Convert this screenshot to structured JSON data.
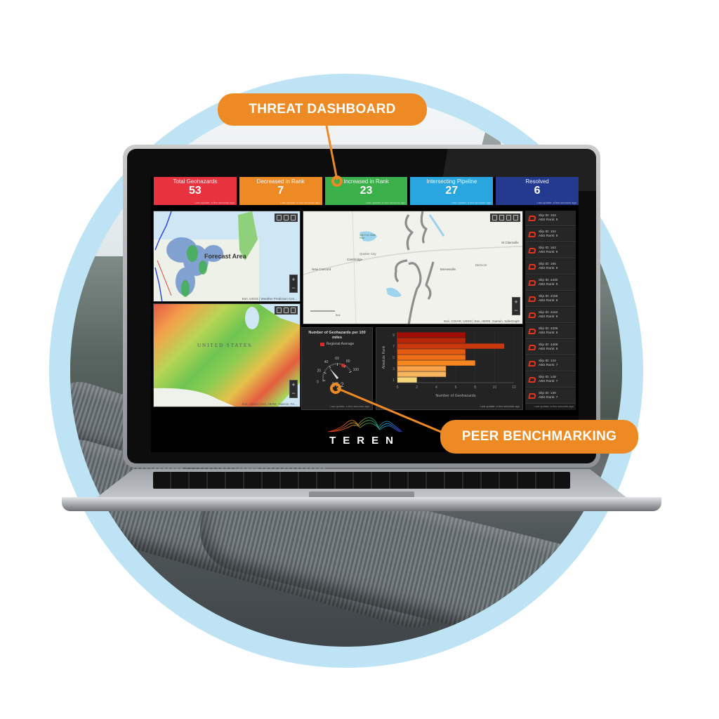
{
  "callouts": {
    "threat_dashboard": "THREAT DASHBOARD",
    "peer_benchmarking": "PEER BENCHMARKING",
    "color": "#ee8a24"
  },
  "dashboard": {
    "cards": [
      {
        "label": "Total Geohazards",
        "value": "53",
        "color": "#e8323e",
        "updated": "Last update: a few seconds ago"
      },
      {
        "label": "Decreased in Rank",
        "value": "7",
        "color": "#ee8a24",
        "updated": "Last update: a few seconds ago"
      },
      {
        "label": "Increased in Rank",
        "value": "23",
        "color": "#3aaf4a",
        "updated": "Last update: a few seconds ago"
      },
      {
        "label": "Intersecting Pipeline",
        "value": "27",
        "color": "#29a6e0",
        "updated": "Last update: a few seconds ago"
      },
      {
        "label": "Resolved",
        "value": "6",
        "color": "#233a8f",
        "updated": "Last update: a few seconds ago"
      }
    ],
    "maps": {
      "weather": {
        "label": "Forecast Area",
        "attribution": "Esri, USGS | Weather Prediction Cen..."
      },
      "heat": {
        "label": "UNITED STATES",
        "attribution": "Esri, USGS | Esri, HERE, Garmin, FA..."
      },
      "pipeline": {
        "places": [
          "New Concord",
          "Cambridge",
          "Salt Fork State Park",
          "Quaker City",
          "Barnesville",
          "Belmont",
          "St Clairsville"
        ],
        "scale": "5mi",
        "attribution": "Esri, CGIAR, USGS | Esri, HERE, Garmin, SafeGraph"
      },
      "zoom_in": "+",
      "zoom_out": "−"
    },
    "slips": [
      {
        "id": "Slip ID: 153",
        "rank": "ABS Rank: 9"
      },
      {
        "id": "Slip ID: 154",
        "rank": "ABS Rank: 9"
      },
      {
        "id": "Slip ID: 163",
        "rank": "ABS Rank: 9"
      },
      {
        "id": "Slip ID: 185",
        "rank": "ABS Rank: 9"
      },
      {
        "id": "Slip ID: 4430",
        "rank": "ABS Rank: 9"
      },
      {
        "id": "Slip ID: 4156",
        "rank": "ABS Rank: 8"
      },
      {
        "id": "Slip ID: 4162",
        "rank": "ABS Rank: 8"
      },
      {
        "id": "Slip ID: 4336",
        "rank": "ABS Rank: 8"
      },
      {
        "id": "Slip ID: 4409",
        "rank": "ABS Rank: 8"
      },
      {
        "id": "Slip ID: 124",
        "rank": "ABS Rank: 7"
      },
      {
        "id": "Slip ID: 128",
        "rank": "ABS Rank: 7"
      },
      {
        "id": "Slip ID: 130",
        "rank": "ABS Rank: 7"
      }
    ],
    "slips_updated": "Last update: a few seconds ago",
    "gauge": {
      "title": "Number of Geohazards per 100 miles",
      "legend": "Regional Average",
      "value": 37.2,
      "value_label": "37.2",
      "regional_average": 75,
      "min": 0,
      "max": 100,
      "ticks": [
        "0",
        "20",
        "40",
        "60",
        "80",
        "100"
      ],
      "updated": "Last update: a few seconds ago"
    },
    "bar_updated": "Last update: a few seconds ago",
    "brand": "TEREN"
  },
  "chart_data": {
    "type": "bar",
    "orientation": "horizontal",
    "title": "",
    "xlabel": "Number of Geohazards",
    "ylabel": "Absolute Rank",
    "categories": [
      "9",
      "8",
      "7",
      "6",
      "5",
      "4",
      "3",
      "2",
      "1"
    ],
    "values": [
      7,
      7,
      11,
      7,
      7,
      8,
      5,
      5,
      2
    ],
    "colors": [
      "#9e0d06",
      "#b8260a",
      "#c9380d",
      "#e55a12",
      "#ee6e16",
      "#f7861e",
      "#f9a24a",
      "#f6b45e",
      "#f3d67a"
    ],
    "x_ticks": [
      "0",
      "2",
      "4",
      "6",
      "8",
      "10",
      "12"
    ],
    "y_ticks": [
      "1",
      "3",
      "5",
      "7",
      "9"
    ],
    "xlim": [
      0,
      12
    ],
    "grid": true
  }
}
